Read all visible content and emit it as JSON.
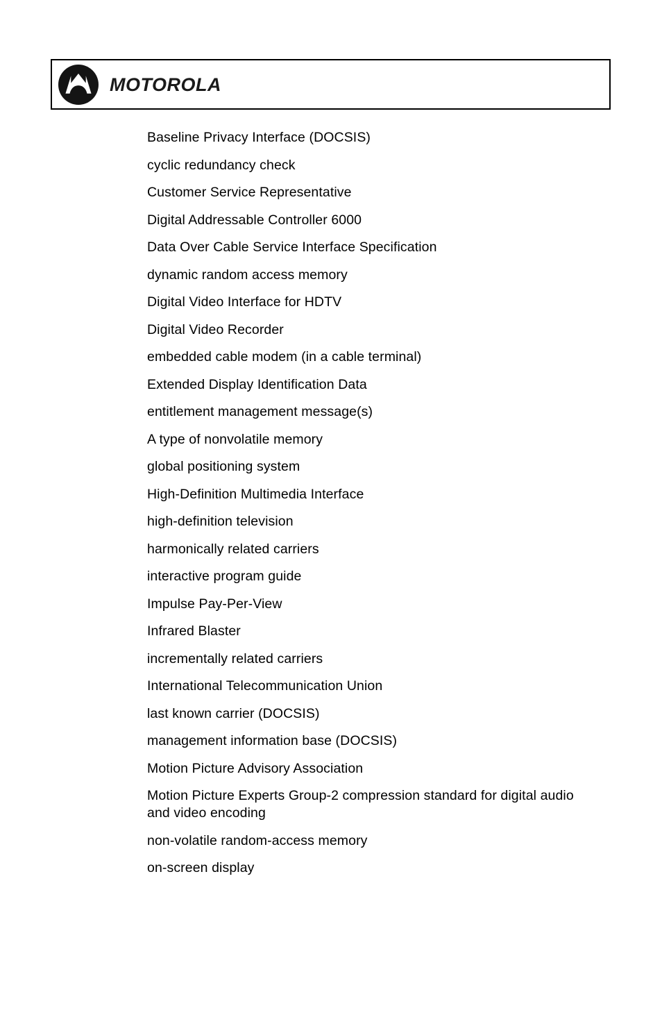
{
  "document": {
    "page_background": "#ffffff",
    "text_color": "#000000",
    "header": {
      "logo_name": "motorola-logo",
      "brand_wordmark": "MOTOROLA",
      "border_color": "#000000"
    },
    "glossary": {
      "definitions": [
        "Baseline Privacy Interface (DOCSIS)",
        "cyclic redundancy check",
        "Customer Service Representative",
        "Digital Addressable Controller 6000",
        "Data Over Cable Service Interface Specification",
        "dynamic random access memory",
        "Digital Video Interface for HDTV",
        "Digital Video Recorder",
        "embedded cable modem (in a cable terminal)",
        "Extended Display Identification Data",
        "entitlement management message(s)",
        "A type of nonvolatile memory",
        "global positioning system",
        "High-Definition Multimedia Interface",
        "high-definition television",
        "harmonically related carriers",
        "interactive program guide",
        "Impulse Pay-Per-View",
        "Infrared Blaster",
        "incrementally related carriers",
        "International Telecommunication Union",
        "last known carrier (DOCSIS)",
        "management information base (DOCSIS)",
        "Motion Picture Advisory Association",
        "Motion Picture Experts Group-2 compression standard for digital audio and video encoding",
        "non-volatile random-access memory",
        "on-screen display"
      ]
    }
  }
}
